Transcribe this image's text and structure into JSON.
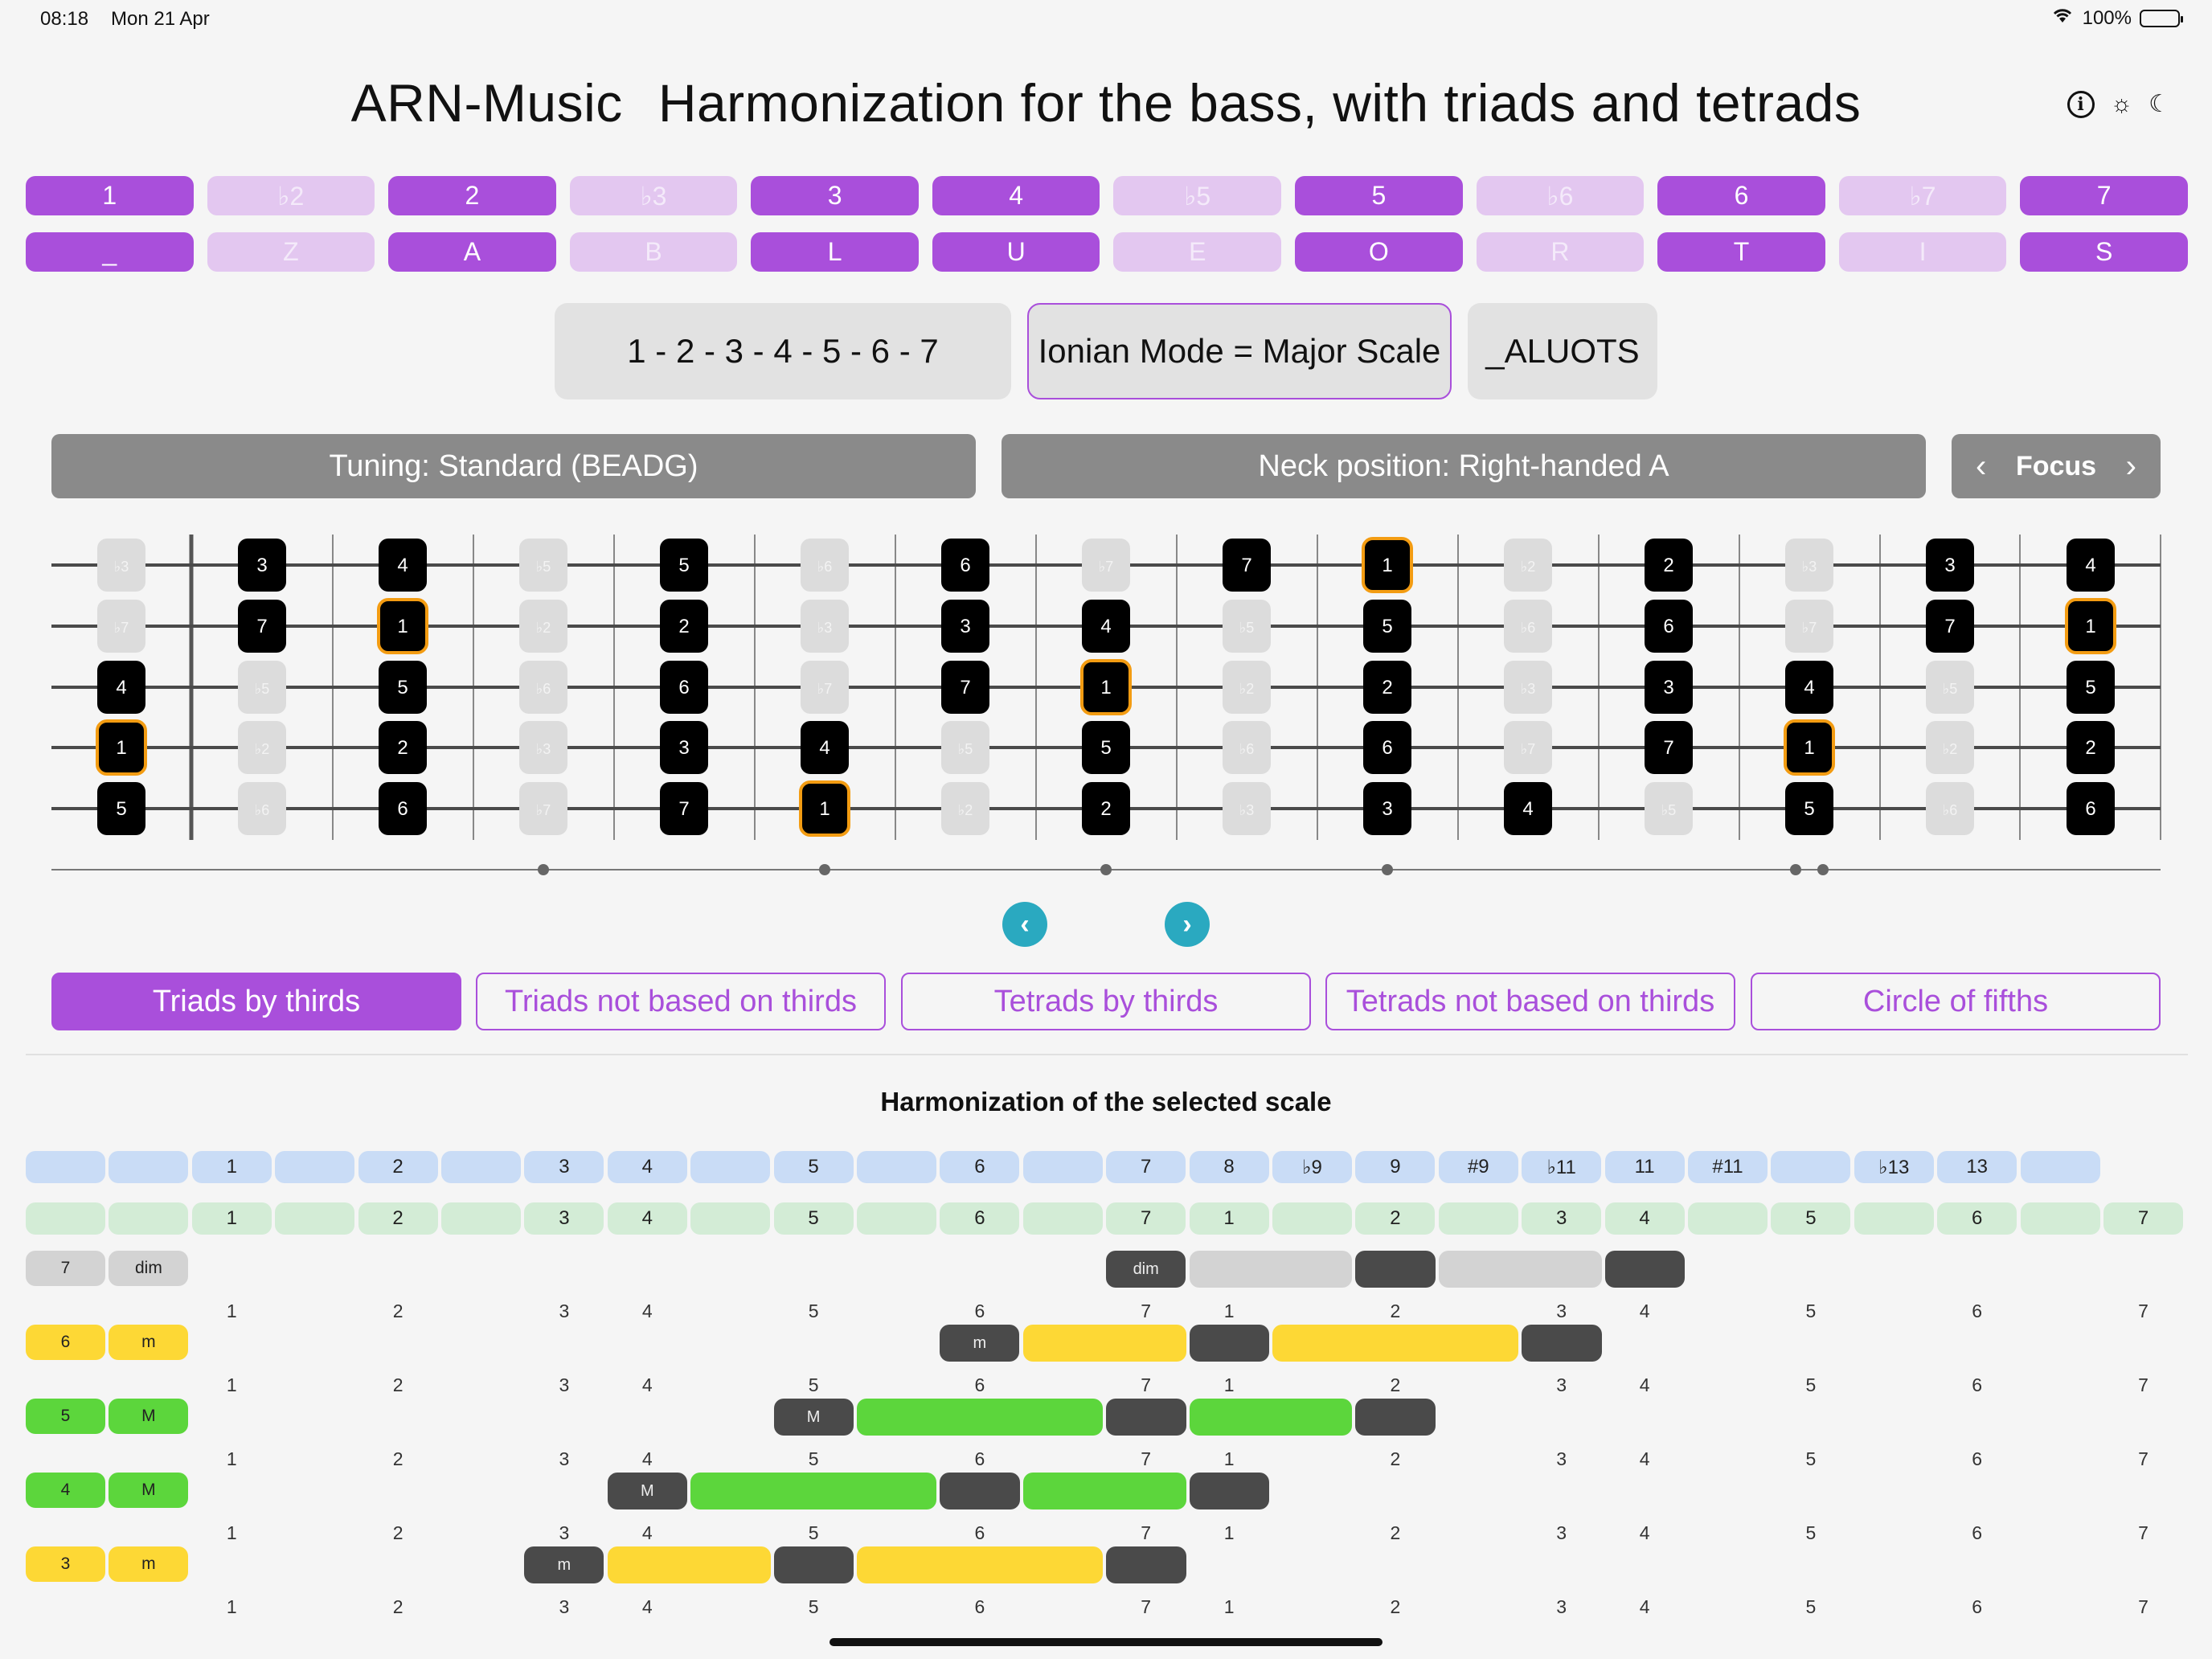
{
  "status": {
    "time": "08:18",
    "date": "Mon 21 Apr",
    "battery": "100%"
  },
  "header": {
    "app_name": "ARN-Music",
    "title": "Harmonization for the bass, with triads and tetrads"
  },
  "intervals": [
    {
      "label": "1",
      "on": true
    },
    {
      "label": "♭2",
      "on": false
    },
    {
      "label": "2",
      "on": true
    },
    {
      "label": "♭3",
      "on": false
    },
    {
      "label": "3",
      "on": true
    },
    {
      "label": "4",
      "on": true
    },
    {
      "label": "♭5",
      "on": false
    },
    {
      "label": "5",
      "on": true
    },
    {
      "label": "♭6",
      "on": false
    },
    {
      "label": "6",
      "on": true
    },
    {
      "label": "♭7",
      "on": false
    },
    {
      "label": "7",
      "on": true
    }
  ],
  "letters": [
    "_",
    "Z",
    "A",
    "B",
    "L",
    "U",
    "E",
    "O",
    "R",
    "T",
    "I",
    "S"
  ],
  "mode": {
    "formula": "1 - 2 - 3 - 4 - 5 - 6 - 7",
    "name": "Ionian Mode = Major Scale",
    "code": "_ALUOTS"
  },
  "controls": {
    "tuning": "Tuning: Standard (BEADG)",
    "neck": "Neck position: Right-handed A",
    "focus": "Focus"
  },
  "fretboard": {
    "strings": [
      [
        "♭3",
        "3",
        "4",
        "♭5",
        "5",
        "♭6",
        "6",
        "♭7",
        "7",
        "1",
        "♭2",
        "2",
        "♭3",
        "3",
        "4"
      ],
      [
        "♭7",
        "7",
        "1",
        "♭2",
        "2",
        "♭3",
        "3",
        "4",
        "♭5",
        "5",
        "♭6",
        "6",
        "♭7",
        "7",
        "1"
      ],
      [
        "4",
        "♭5",
        "5",
        "♭6",
        "6",
        "♭7",
        "7",
        "1",
        "♭2",
        "2",
        "♭3",
        "3",
        "4",
        "♭5",
        "5"
      ],
      [
        "1",
        "♭2",
        "2",
        "♭3",
        "3",
        "4",
        "♭5",
        "5",
        "♭6",
        "6",
        "♭7",
        "7",
        "1",
        "♭2",
        "2"
      ],
      [
        "5",
        "♭6",
        "6",
        "♭7",
        "7",
        "1",
        "♭2",
        "2",
        "♭3",
        "3",
        "4",
        "♭5",
        "5",
        "♭6",
        "6"
      ]
    ],
    "scale_degrees": [
      "1",
      "2",
      "3",
      "4",
      "5",
      "6",
      "7"
    ],
    "root": "1",
    "inlay_frets": [
      3,
      5,
      7,
      9,
      12
    ]
  },
  "tabs": [
    {
      "label": "Triads by thirds",
      "active": true
    },
    {
      "label": "Triads not based on thirds",
      "active": false
    },
    {
      "label": "Tetrads by thirds",
      "active": false
    },
    {
      "label": "Tetrads not based on thirds",
      "active": false
    },
    {
      "label": "Circle of fifths",
      "active": false
    }
  ],
  "harmonization": {
    "title": "Harmonization of the selected scale",
    "interval_header": [
      "",
      "",
      "1",
      "",
      "2",
      "",
      "3",
      "4",
      "",
      "5",
      "",
      "6",
      "",
      "7",
      "8",
      "♭9",
      "9",
      "#9",
      "♭11",
      "11",
      "#11",
      "",
      "♭13",
      "13",
      ""
    ],
    "degree_header": [
      "",
      "",
      "1",
      "",
      "2",
      "",
      "3",
      "4",
      "",
      "5",
      "",
      "6",
      "",
      "7",
      "1",
      "",
      "2",
      "",
      "3",
      "4",
      "",
      "5",
      "",
      "6",
      "",
      "7"
    ],
    "number_line": [
      "1",
      "2",
      "3",
      "4",
      "5",
      "6",
      "7",
      "1",
      "2",
      "3",
      "4",
      "5",
      "6",
      "7"
    ],
    "rows": [
      {
        "degree": "7",
        "quality": "dim",
        "color": "#d3d3d3",
        "start": 13,
        "marker": "dim",
        "segments": [
          [
            "light",
            14,
            16
          ],
          [
            "dark",
            16,
            17
          ],
          [
            "light",
            17,
            19
          ],
          [
            "dark",
            19,
            20
          ]
        ]
      },
      {
        "degree": "6",
        "quality": "m",
        "color": "#fdd835",
        "start": 11,
        "marker": "m",
        "segments": [
          [
            "light",
            12,
            14
          ],
          [
            "dark",
            14,
            15
          ],
          [
            "light",
            15,
            18
          ],
          [
            "dark",
            18,
            19
          ]
        ]
      },
      {
        "degree": "5",
        "quality": "M",
        "color": "#5cd63c",
        "start": 9,
        "marker": "M",
        "segments": [
          [
            "light",
            10,
            13
          ],
          [
            "dark",
            13,
            14
          ],
          [
            "light",
            14,
            16
          ],
          [
            "dark",
            16,
            17
          ]
        ]
      },
      {
        "degree": "4",
        "quality": "M",
        "color": "#5cd63c",
        "start": 7,
        "marker": "M",
        "segments": [
          [
            "light",
            8,
            11
          ],
          [
            "dark",
            11,
            12
          ],
          [
            "light",
            12,
            14
          ],
          [
            "dark",
            14,
            15
          ]
        ]
      },
      {
        "degree": "3",
        "quality": "m",
        "color": "#fdd835",
        "start": 6,
        "marker": "m",
        "segments": [
          [
            "light",
            7,
            9
          ],
          [
            "dark",
            9,
            10
          ],
          [
            "light",
            10,
            13
          ],
          [
            "dark",
            13,
            14
          ]
        ]
      }
    ]
  }
}
